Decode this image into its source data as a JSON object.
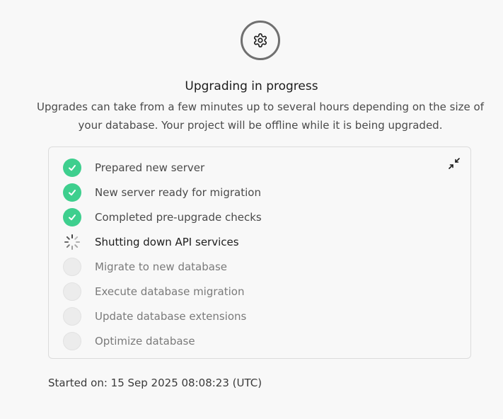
{
  "header": {
    "icon": "gear-icon",
    "title": "Upgrading in progress",
    "description": "Upgrades can take from a few minutes up to several hours depending on the size of your database. Your project will be offline while it is being upgraded."
  },
  "progress": {
    "collapse_icon": "collapse-arrows-icon",
    "steps": [
      {
        "label": "Prepared new server",
        "status": "done"
      },
      {
        "label": "New server ready for migration",
        "status": "done"
      },
      {
        "label": "Completed pre-upgrade checks",
        "status": "done"
      },
      {
        "label": "Shutting down API services",
        "status": "in-progress"
      },
      {
        "label": "Migrate to new database",
        "status": "pending"
      },
      {
        "label": "Execute database migration",
        "status": "pending"
      },
      {
        "label": "Update database extensions",
        "status": "pending"
      },
      {
        "label": "Optimize database",
        "status": "pending"
      }
    ]
  },
  "footer": {
    "started_on": "Started on: 15 Sep 2025 08:08:23 (UTC)"
  },
  "colors": {
    "success": "#3ecf8e",
    "pending": "#ececec"
  }
}
